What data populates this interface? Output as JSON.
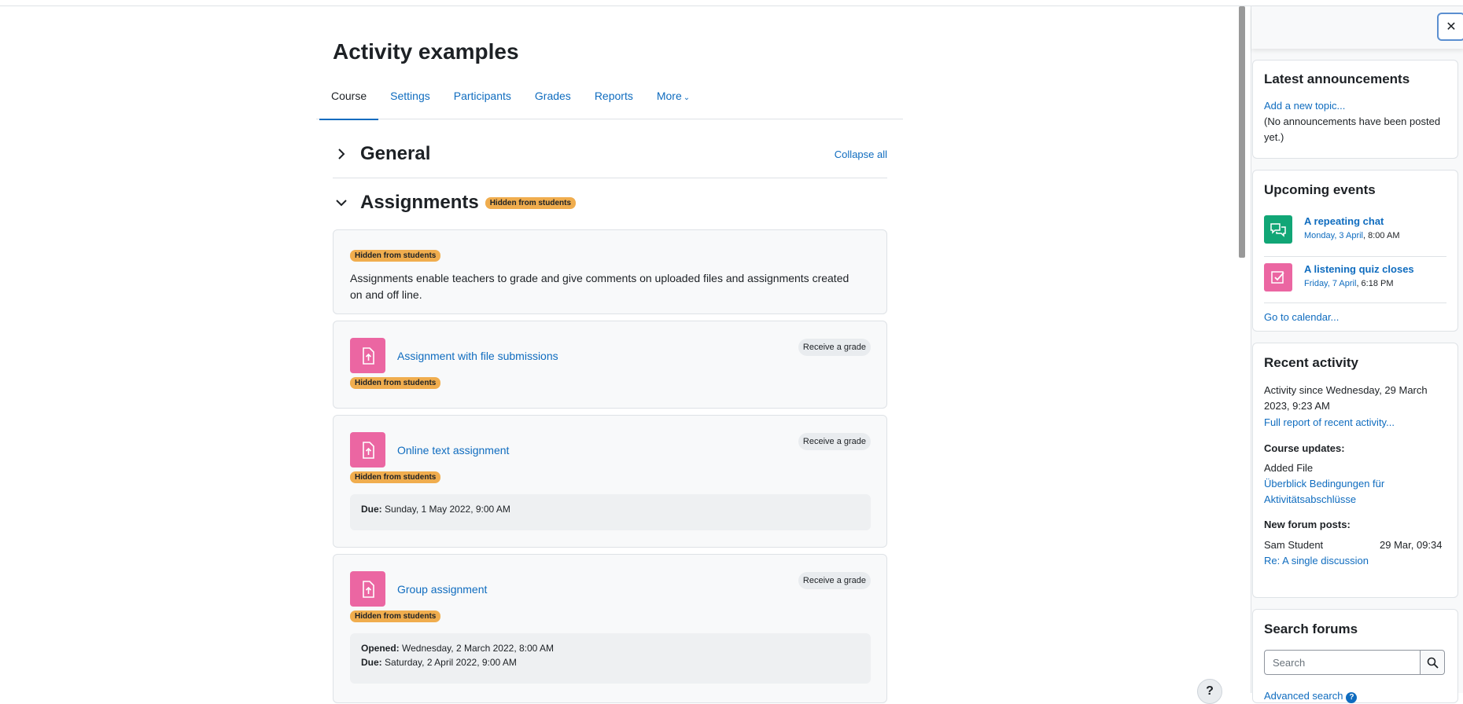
{
  "page": {
    "title": "Activity examples",
    "tabs": [
      {
        "label": "Course",
        "active": true
      },
      {
        "label": "Settings"
      },
      {
        "label": "Participants"
      },
      {
        "label": "Grades"
      },
      {
        "label": "Reports"
      },
      {
        "label": "More"
      }
    ]
  },
  "sections": {
    "general": {
      "title": "General",
      "collapse_all": "Collapse all"
    },
    "assignments": {
      "title": "Assignments",
      "badge": "Hidden from students",
      "summary_badge": "Hidden from students",
      "summary": "Assignments enable teachers to grade and give comments on uploaded files and assignments created on and off line.",
      "activities": [
        {
          "name": "Assignment with file submissions",
          "badge": "Hidden from students",
          "completion": "Receive a grade"
        },
        {
          "name": "Online text assignment",
          "badge": "Hidden from students",
          "completion": "Receive a grade",
          "due_label": "Due:",
          "due": "Sunday, 1 May 2022, 9:00 AM"
        },
        {
          "name": "Group assignment",
          "badge": "Hidden from students",
          "completion": "Receive a grade",
          "opened_label": "Opened:",
          "opened": "Wednesday, 2 March 2022, 8:00 AM",
          "due_label": "Due:",
          "due": "Saturday, 2 April 2022, 9:00 AM"
        }
      ]
    }
  },
  "help_button": "?",
  "drawer": {
    "close": "✕",
    "announcements": {
      "title": "Latest announcements",
      "add_link": "Add a new topic...",
      "empty": "(No announcements have been posted yet.)"
    },
    "upcoming": {
      "title": "Upcoming events",
      "events": [
        {
          "name": "A repeating chat",
          "date_link": "Monday, 3 April",
          "time": ", 8:00 AM",
          "icon": "chat-icon",
          "color": "#11a676"
        },
        {
          "name": "A listening quiz closes",
          "date_link": "Friday, 7 April",
          "time": ", 6:18 PM",
          "icon": "quiz-icon",
          "color": "#eb66a2"
        }
      ],
      "calendar_link": "Go to calendar..."
    },
    "recent": {
      "title": "Recent activity",
      "since": "Activity since Wednesday, 29 March 2023, 9:23 AM",
      "full_report": "Full report of recent activity...",
      "updates_heading": "Course updates:",
      "added": "Added File",
      "file_link": "Überblick Bedingungen für Aktivitätsabschlüsse",
      "posts_heading": "New forum posts:",
      "post_author": "Sam Student",
      "post_date": "29 Mar, 09:34",
      "post_link": "Re: A single discussion"
    },
    "search_forums": {
      "title": "Search forums",
      "placeholder": "Search",
      "advanced": "Advanced search"
    }
  },
  "colors": {
    "link": "#0f6cbf",
    "badge": "#f0ad4e",
    "assign_icon": "#eb66a2"
  }
}
